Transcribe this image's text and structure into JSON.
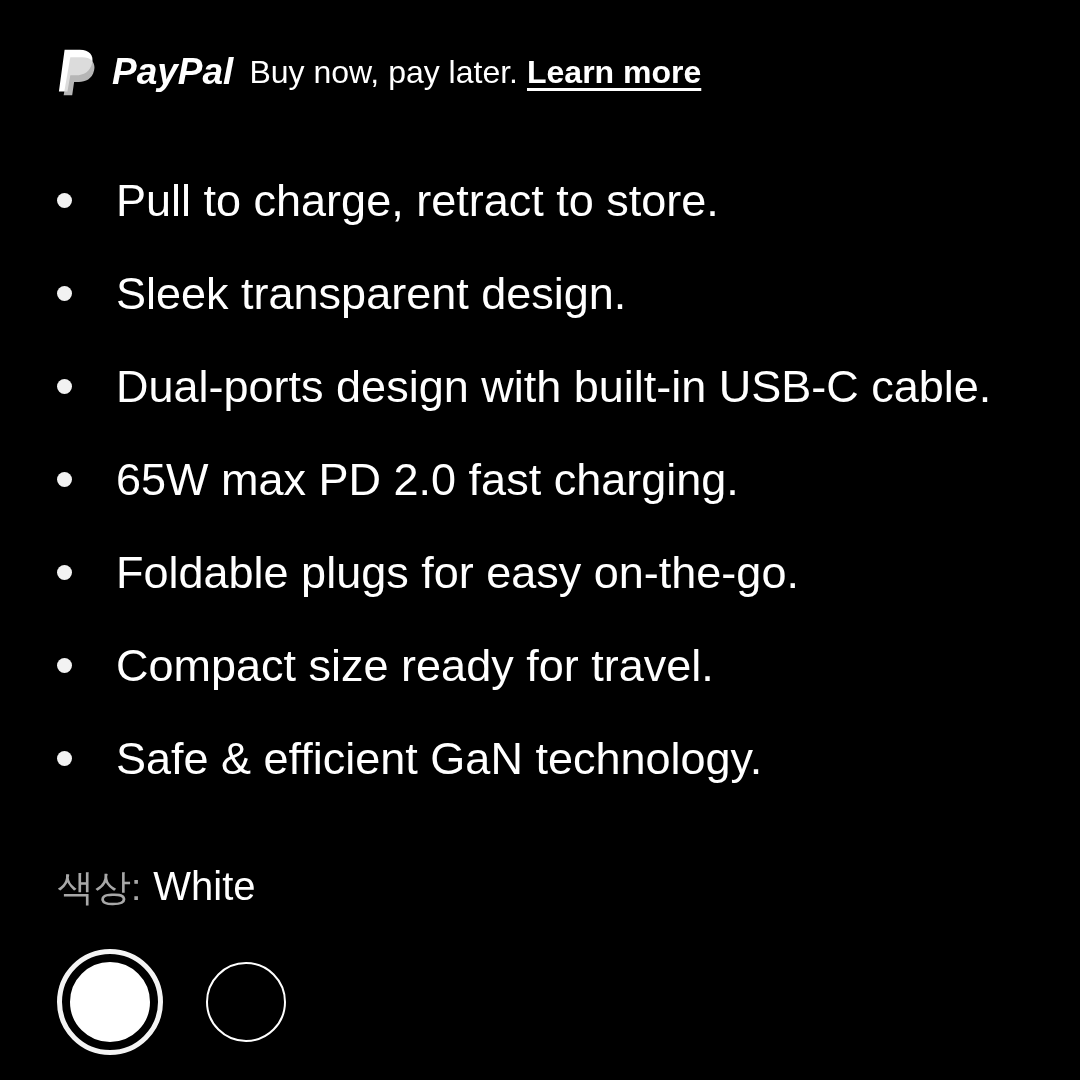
{
  "paypal_banner": {
    "brand": "PayPal",
    "message": "Buy now, pay later.",
    "link": "Learn more"
  },
  "features": [
    "Pull to charge, retract to store.",
    "Sleek transparent design.",
    "Dual-ports design with built-in USB-C cable.",
    "65W max PD 2.0 fast charging.",
    "Foldable plugs for easy on-the-go.",
    "Compact size ready for travel.",
    "Safe & efficient GaN technology."
  ],
  "color": {
    "label": "색상:",
    "value": "White",
    "swatches": [
      {
        "color": "#ffffff",
        "selected": true
      },
      {
        "color": "#000000",
        "selected": false
      }
    ]
  }
}
